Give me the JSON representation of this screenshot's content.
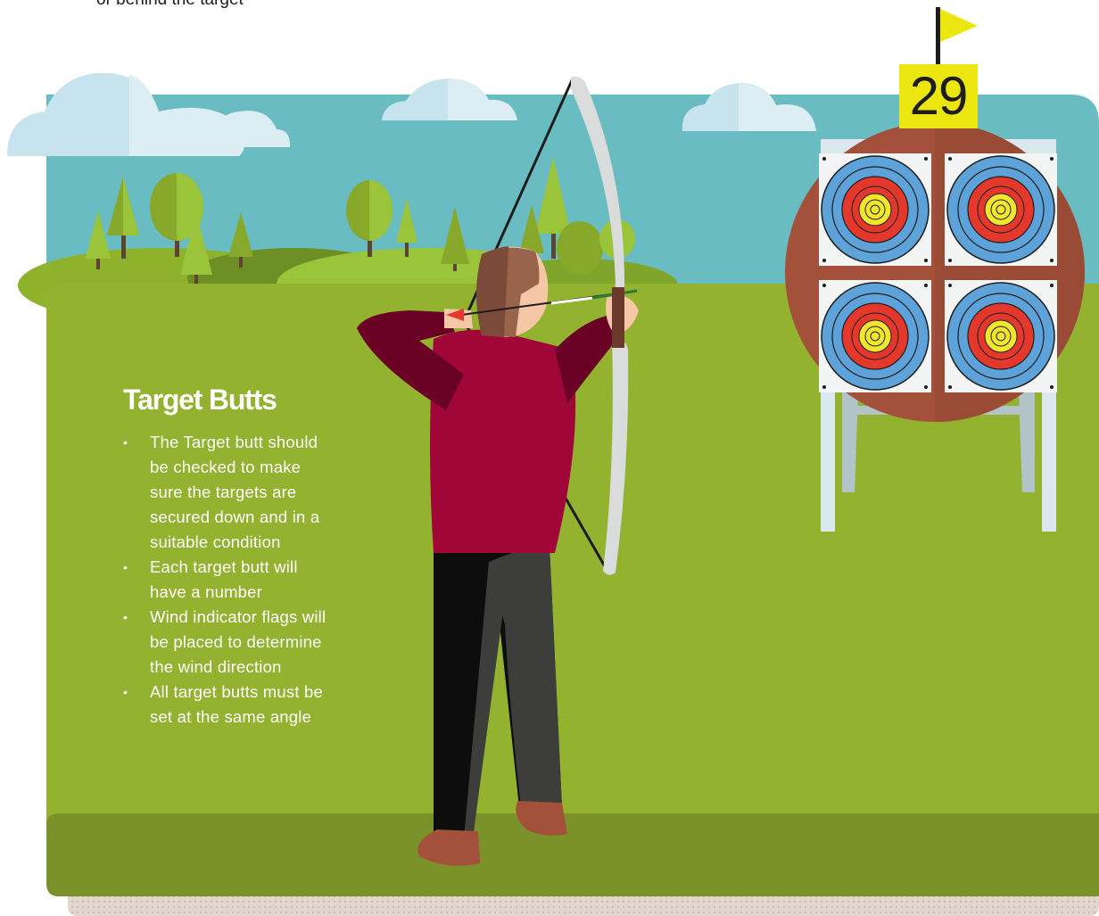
{
  "intro": {
    "lines": [
      "or behind the target"
    ]
  },
  "target": {
    "number": "29"
  },
  "section": {
    "title": "Target Butts",
    "bullets": [
      {
        "lines": [
          "The Target butt should",
          "be checked to make",
          "sure the targets are",
          "secured down and in a",
          "suitable condition"
        ]
      },
      {
        "lines": [
          "Each target butt will",
          "have a number"
        ]
      },
      {
        "lines": [
          "Wind indicator flags will",
          "be placed to determine",
          "the wind direction"
        ]
      },
      {
        "lines": [
          "All target butts must be",
          "set at the same angle"
        ]
      }
    ]
  },
  "colors": {
    "sky": "#6abcc3",
    "grass": "#93b22f",
    "grass_dark": "#7b922b",
    "butt": "#a3513a",
    "flag": "#ece610",
    "shirt": "#a10639",
    "target_blue": "#5da3d9",
    "target_red": "#e5382c",
    "target_yellow": "#f2e52d"
  },
  "icons": {
    "flag": "wind-flag-icon",
    "cloud": "cloud-icon",
    "tree": "tree-icon",
    "target": "target-face-icon"
  }
}
